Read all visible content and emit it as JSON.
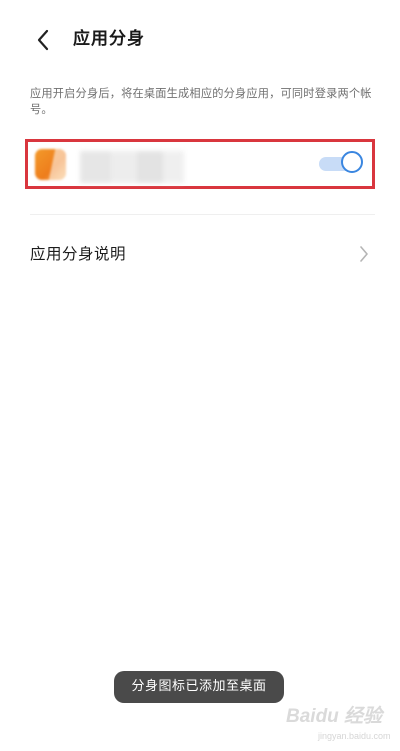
{
  "header": {
    "title": "应用分身",
    "back_icon": "chevron-left-icon"
  },
  "description": "应用开启分身后，将在桌面生成相应的分身应用，可同时登录两个帐号。",
  "app_row": {
    "icon": "app-icon-blurred",
    "toggle_on": true,
    "colors": {
      "highlight_border": "#d9363e",
      "toggle_track": "#c8dcf7",
      "toggle_knob_border": "#3a86e0",
      "icon": "#ee7d1c"
    }
  },
  "info_row": {
    "label": "应用分身说明",
    "chevron_icon": "chevron-right-icon"
  },
  "toast": {
    "text": "分身图标已添加至桌面"
  },
  "watermark": {
    "brand": "Baidu 经验",
    "url": "jingyan.baidu.com"
  }
}
